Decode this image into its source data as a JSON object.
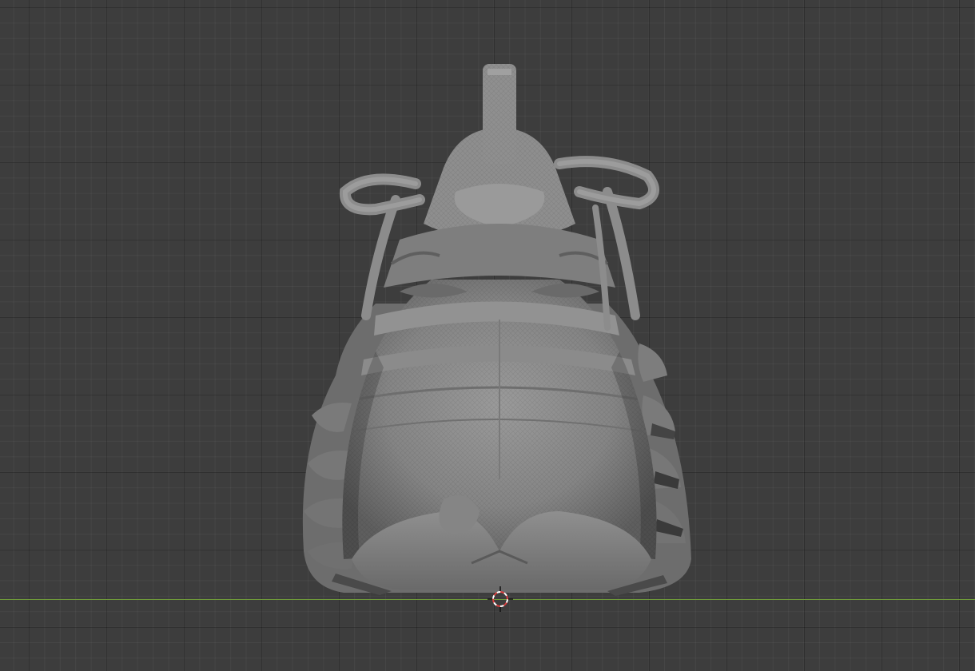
{
  "viewport": {
    "background_color": "#3d3d3d",
    "x_axis_color": "#6e9a3a",
    "mesh_color": "#8a8a8a",
    "cursor_colors": [
      "#d94040",
      "#ffffff"
    ]
  },
  "object": {
    "description_icon": "mesh-object-icon"
  },
  "cursor": {
    "icon": "3d-cursor-icon"
  }
}
